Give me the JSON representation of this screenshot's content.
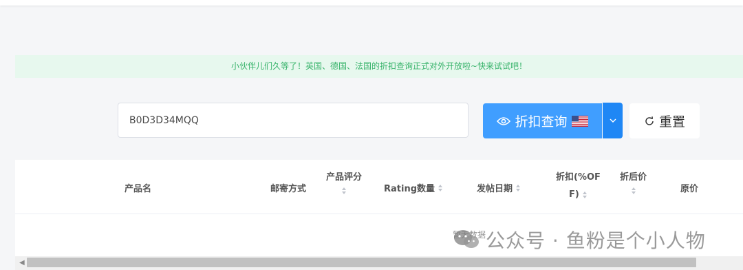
{
  "notice": {
    "text": "小伙伴儿们久等了！英国、德国、法国的折扣查询正式对外开放啦~快来试试吧！"
  },
  "search": {
    "value": "B0D3D34MQQ"
  },
  "buttons": {
    "query_label": "折扣查询",
    "reset_label": "重置"
  },
  "table": {
    "columns": [
      {
        "label": "产品名",
        "sortable": false
      },
      {
        "label": "邮寄方式",
        "sortable": false
      },
      {
        "label": "产品评分",
        "sortable": true
      },
      {
        "label": "Rating数量",
        "sortable": true
      },
      {
        "label": "发帖日期",
        "sortable": true
      },
      {
        "label": "折扣(%OFF)",
        "line1": "折扣(%OF",
        "line2": "F)",
        "sortable": true
      },
      {
        "label": "折后价",
        "sortable": true
      },
      {
        "label": "原价",
        "sortable": false
      }
    ],
    "empty_text": "暂无数据"
  },
  "watermark": {
    "text": "公众号 · 鱼粉是个小人物"
  },
  "colors": {
    "primary": "#409eff",
    "notice_bg": "#e7f8ee",
    "notice_text": "#38b36b"
  }
}
